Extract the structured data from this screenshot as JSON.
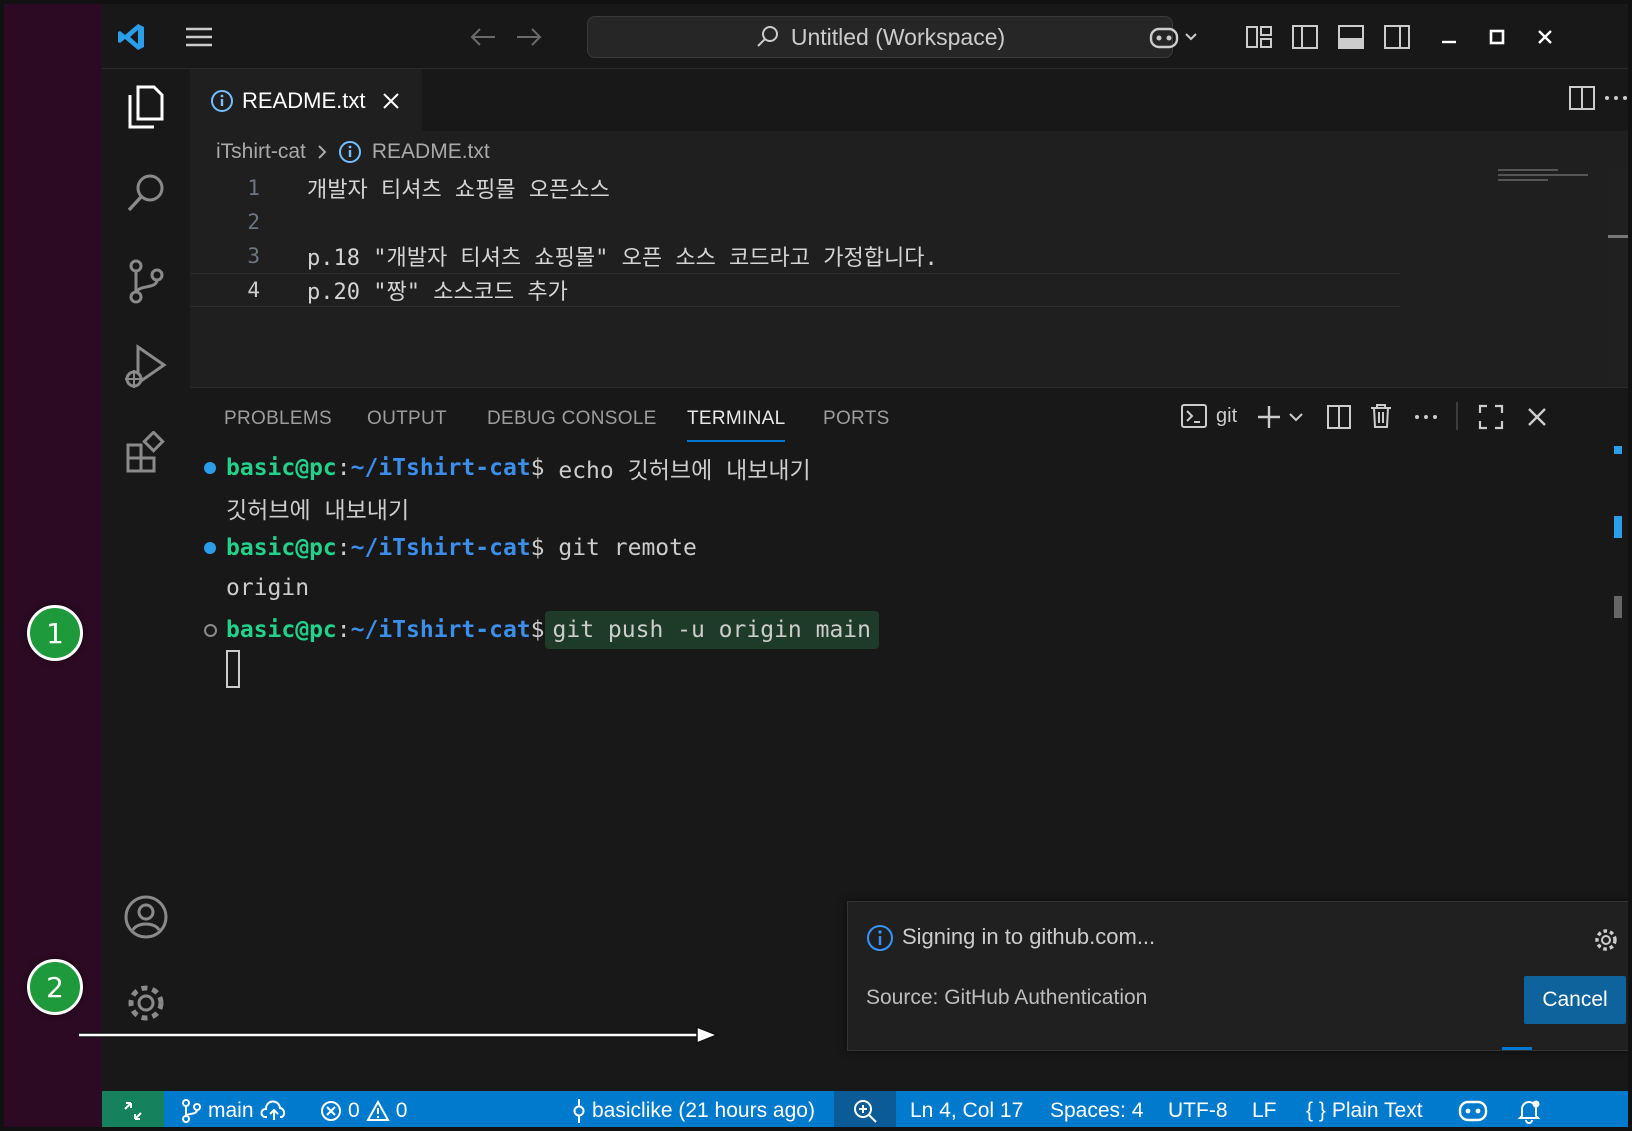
{
  "titlebar": {
    "search_text": "Untitled (Workspace)"
  },
  "editor": {
    "tab_label": "README.txt",
    "breadcrumb": {
      "folder": "iTshirt-cat",
      "file": "README.txt"
    },
    "lines": [
      {
        "num": "1",
        "text": "개발자 티셔츠 쇼핑몰 오픈소스"
      },
      {
        "num": "2",
        "text": ""
      },
      {
        "num": "3",
        "text": "p.18 \"개발자 티셔츠 쇼핑몰\" 오픈 소스 코드라고 가정합니다."
      },
      {
        "num": "4",
        "text": "p.20 \"짱\" 소스코드 추가"
      }
    ]
  },
  "panel": {
    "tabs": [
      "PROBLEMS",
      "OUTPUT",
      "DEBUG CONSOLE",
      "TERMINAL",
      "PORTS"
    ],
    "terminal_name": "git",
    "terminal": {
      "user": "basic@pc",
      "path": "~/iTshirt-cat",
      "line1_cmd": "echo 깃허브에 내보내기",
      "line2_out": "깃허브에 내보내기",
      "line3_cmd": "git remote",
      "line4_out": "origin",
      "line5_cmd": "git push -u origin main"
    }
  },
  "notification": {
    "title": "Signing in to github.com...",
    "source": "Source: GitHub Authentication",
    "cancel_label": "Cancel"
  },
  "statusbar": {
    "branch": "main",
    "errors": "0",
    "warnings": "0",
    "commit": "basiclike (21 hours ago)",
    "position": "Ln 4, Col 17",
    "spaces": "Spaces: 4",
    "encoding": "UTF-8",
    "eol": "LF",
    "language": "Plain Text"
  },
  "annotations": {
    "badge1": "1",
    "badge2": "2"
  },
  "colors": {
    "accent": "#007acc",
    "remote": "#16825d",
    "prompt_user": "#23d18b",
    "prompt_path": "#3b8eea",
    "badge": "#1e9a3c"
  }
}
